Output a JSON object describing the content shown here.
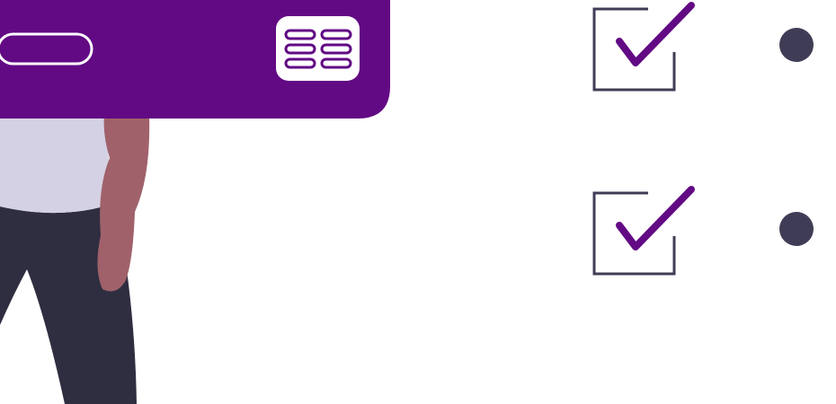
{
  "colors": {
    "card": "#620a84",
    "card_icon_bg": "#ffffff",
    "card_icon_stroke": "#620a84",
    "pill_outline": "#ffffff",
    "check_mark": "#620a84",
    "check_box": "#3f3d56",
    "bullet": "#3f3d56",
    "shirt": "#d3d1e3",
    "pants": "#2f2e41",
    "skin": "#a0616a"
  },
  "icons": {
    "card_icon": "list-rows-icon",
    "check": "checkbox-checked-icon",
    "bullet": "bullet-dot-icon"
  },
  "checklist": {
    "items": [
      {
        "checked": true
      },
      {
        "checked": true
      }
    ]
  }
}
